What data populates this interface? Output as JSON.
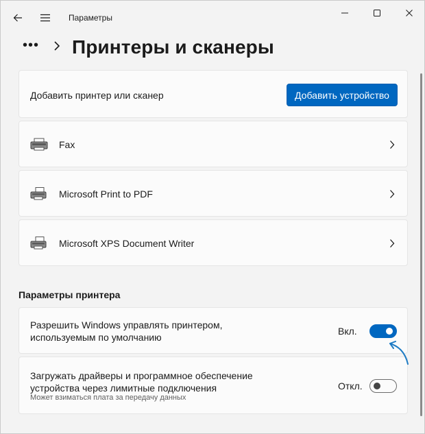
{
  "window": {
    "title": "Параметры",
    "controls": [
      "minimize-icon",
      "maximize-icon",
      "close-icon"
    ]
  },
  "header": {
    "more": "•••",
    "page_title": "Принтеры и сканеры"
  },
  "add_card": {
    "label": "Добавить принтер или сканер",
    "button_label": "Добавить устройство"
  },
  "printers": [
    {
      "name": "Fax",
      "icon": "printer-icon"
    },
    {
      "name": "Microsoft Print to PDF",
      "icon": "printer-icon"
    },
    {
      "name": "Microsoft XPS Document Writer",
      "icon": "printer-icon"
    }
  ],
  "printer_settings": {
    "section_title": "Параметры принтера",
    "default_printer": {
      "text": "Разрешить Windows управлять принтером, используемым по умолчанию",
      "state_label": "Вкл.",
      "on": true
    },
    "metered_drivers": {
      "text": "Загружать драйверы и программное обеспечение устройства через лимитные подключения",
      "subtext": "Может взиматься плата за передачу данных",
      "state_label": "Откл.",
      "on": false
    }
  },
  "colors": {
    "accent": "#0067c0",
    "background": "#f3f3f3",
    "card": "#fbfbfb",
    "annotation_arrow": "#1e7bc4"
  }
}
